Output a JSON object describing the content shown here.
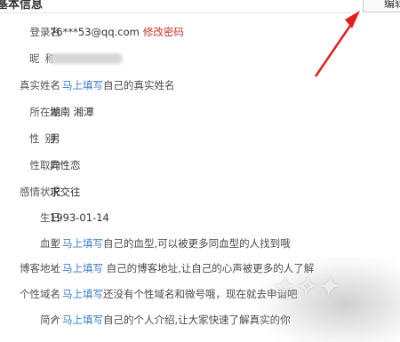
{
  "header": {
    "title": "基本信息",
    "edit_label": "编辑"
  },
  "fields": [
    {
      "label": "登录名",
      "value": "76***53@qq.com",
      "link": "修改密码"
    },
    {
      "label": "昵称",
      "value": ""
    },
    {
      "label": "真实姓名",
      "hint_prefix": "马上填写",
      "hint": "自己的真实姓名"
    },
    {
      "label": "所在地",
      "value": "湖南 湘潭"
    },
    {
      "label": "性别",
      "value": "男"
    },
    {
      "label": "性取向",
      "value": "异性恋"
    },
    {
      "label": "感情状况",
      "value": "求交往"
    },
    {
      "label": "生日",
      "value": "1993-01-14"
    },
    {
      "label": "血型",
      "hint_prefix": "马上填写",
      "hint": "自己的血型,可以被更多同血型的人找到哦"
    },
    {
      "label": "博客地址",
      "hint_prefix": "马上填写",
      "hint": " 自己的博客地址,让自己的心声被更多的人了解"
    },
    {
      "label": "个性域名",
      "hint_prefix": "马上填写",
      "hint": "还没有个性域名和微号哦，现在就去申请吧"
    },
    {
      "label": "简介",
      "hint_prefix": "马上填写",
      "hint": "自己的个人介绍,让大家快速了解真实的你"
    }
  ],
  "colors": {
    "link": "#c5372f",
    "hint_prefix": "#3a7bc8",
    "arrow": "#e02020"
  },
  "icons": {
    "hint": "pencil-icon"
  }
}
